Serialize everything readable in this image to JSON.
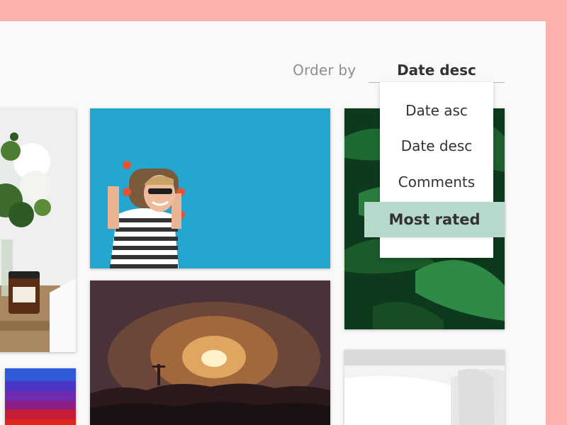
{
  "sort": {
    "label": "Order by",
    "selected": "Date desc",
    "options": [
      "Date asc",
      "Date desc",
      "Comments",
      "Most rated"
    ],
    "highlighted": "Most rated"
  },
  "colors": {
    "page_background": "#fdb1ad",
    "panel_background": "#f9f9f9",
    "highlight": "#b6d9cc"
  }
}
